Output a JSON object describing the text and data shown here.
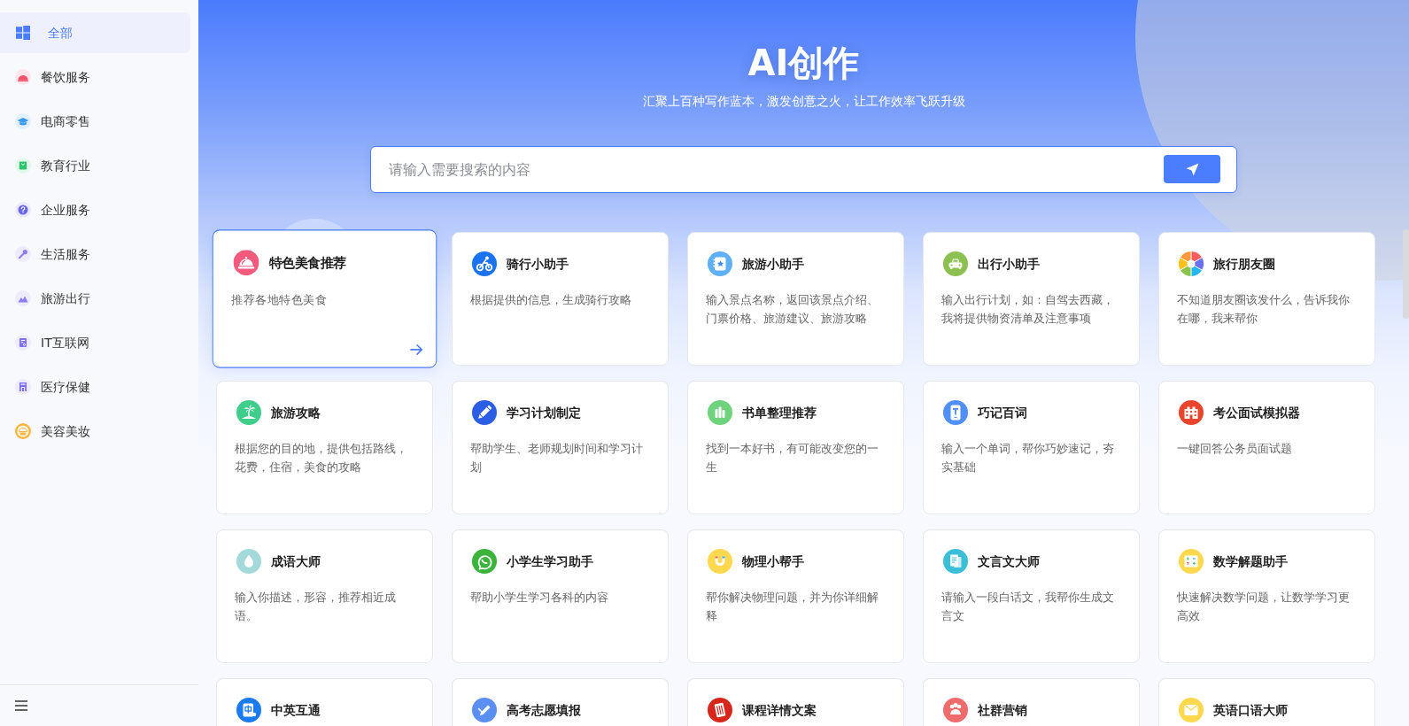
{
  "sidebar": {
    "items": [
      {
        "label": "全部",
        "selected": true
      },
      {
        "label": "餐饮服务",
        "selected": false
      },
      {
        "label": "电商零售",
        "selected": false
      },
      {
        "label": "教育行业",
        "selected": false
      },
      {
        "label": "企业服务",
        "selected": false
      },
      {
        "label": "生活服务",
        "selected": false
      },
      {
        "label": "旅游出行",
        "selected": false
      },
      {
        "label": "IT互联网",
        "selected": false
      },
      {
        "label": "医疗保健",
        "selected": false
      },
      {
        "label": "美容美妆",
        "selected": false
      }
    ]
  },
  "hero": {
    "title": "AI创作",
    "subtitle": "汇聚上百种写作蓝本，激发创意之火，让工作效率飞跃升级"
  },
  "search": {
    "placeholder": "请输入需要搜索的内容"
  },
  "cards": [
    {
      "title": "特色美食推荐",
      "description": "推荐各地特色美食",
      "selected": true
    },
    {
      "title": "骑行小助手",
      "description": "根据提供的信息，生成骑行攻略",
      "selected": false
    },
    {
      "title": "旅游小助手",
      "description": "输入景点名称，返回该景点介绍、门票价格、旅游建议、旅游攻略",
      "selected": false
    },
    {
      "title": "出行小助手",
      "description": "输入出行计划，如：自驾去西藏，我将提供物资清单及注意事项",
      "selected": false
    },
    {
      "title": "旅行朋友圈",
      "description": "不知道朋友圈该发什么，告诉我你在哪，我来帮你",
      "selected": false
    },
    {
      "title": "旅游攻略",
      "description": "根据您的目的地，提供包括路线，花费，住宿，美食的攻略",
      "selected": false
    },
    {
      "title": "学习计划制定",
      "description": "帮助学生、老师规划时间和学习计划",
      "selected": false
    },
    {
      "title": "书单整理推荐",
      "description": "找到一本好书，有可能改变您的一生",
      "selected": false
    },
    {
      "title": "巧记百词",
      "description": "输入一个单词，帮你巧妙速记，夯实基础",
      "selected": false
    },
    {
      "title": "考公面试模拟器",
      "description": "一键回答公务员面试题",
      "selected": false
    },
    {
      "title": "成语大师",
      "description": "输入你描述，形容，推荐相近成语。",
      "selected": false
    },
    {
      "title": "小学生学习助手",
      "description": "帮助小学生学习各科的内容",
      "selected": false
    },
    {
      "title": "物理小帮手",
      "description": "帮你解决物理问题，并为你详细解释",
      "selected": false
    },
    {
      "title": "文言文大师",
      "description": "请输入一段白话文，我帮你生成文言文",
      "selected": false
    },
    {
      "title": "数学解题助手",
      "description": "快速解决数学问题，让数学学习更高效",
      "selected": false
    },
    {
      "title": "中英互通",
      "selected": false
    },
    {
      "title": "高考志愿填报",
      "selected": false
    },
    {
      "title": "课程详情文案",
      "selected": false
    },
    {
      "title": "社群营销",
      "selected": false
    },
    {
      "title": "英语口语大师",
      "selected": false
    }
  ]
}
